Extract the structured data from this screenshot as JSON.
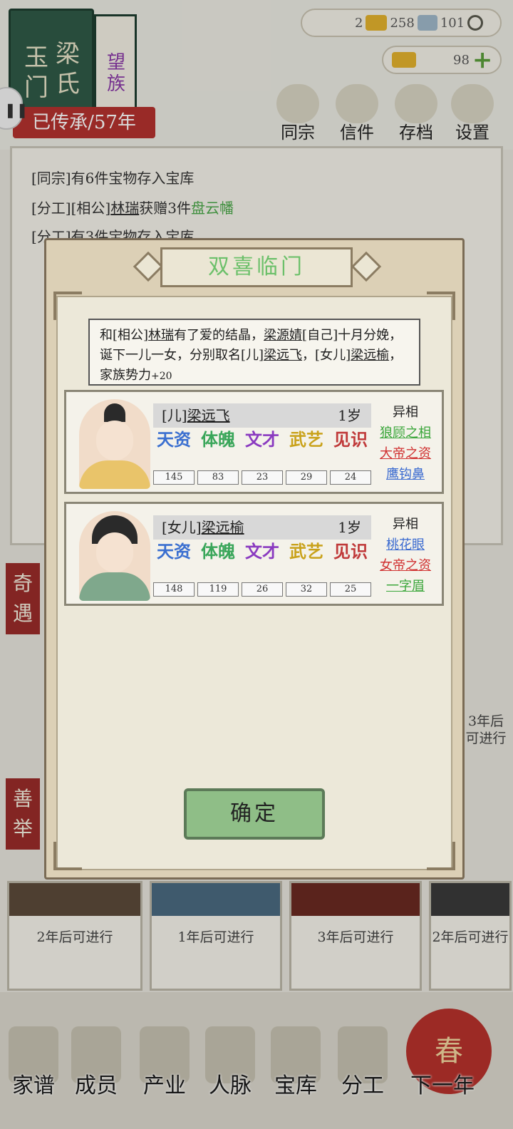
{
  "header": {
    "book_title_1": "玉门",
    "book_title_2": "梁氏",
    "book_tag": "望族",
    "inherit": "已传承/57年"
  },
  "resources": {
    "gold": "2",
    "ingot": "258",
    "silver": "101",
    "yuanbao": "98"
  },
  "top_nav": [
    {
      "label": "同宗",
      "icon": "books-icon"
    },
    {
      "label": "信件",
      "icon": "letter-icon"
    },
    {
      "label": "存档",
      "icon": "scroll-icon"
    },
    {
      "label": "设置",
      "icon": "gear-icon"
    }
  ],
  "log": {
    "line1": "[同宗]有6件宝物存入宝库",
    "line2a": "[分工][相公]",
    "line2b": "林瑞",
    "line2c": "获赠3件",
    "line2d": "盘云幡",
    "line3": "[分工]有3件宝物存入宝库"
  },
  "side_tags": {
    "a": "奇遇",
    "b": "善举"
  },
  "slots": [
    {
      "text": "2年后可进行"
    },
    {
      "text": "1年后可进行"
    },
    {
      "text": "3年后可进行"
    },
    {
      "text": "2年后可进行"
    }
  ],
  "right_slot_text": "3年后可进行",
  "bottom_nav": [
    "家谱",
    "成员",
    "产业",
    "人脉",
    "宝库",
    "分工",
    "下一年"
  ],
  "spring": "春",
  "modal": {
    "title": "双喜临门",
    "msg_a": "和[相公]",
    "msg_b": "林瑞",
    "msg_c": "有了爱的结晶，",
    "msg_d": "梁源婧",
    "msg_e": "[自己]十月分娩，诞下一儿一女，分别取名[儿]",
    "msg_f": "梁远飞",
    "msg_g": "，[女儿]",
    "msg_h": "梁远榆",
    "msg_i": "，家族势力",
    "msg_j": "+20",
    "confirm": "确定"
  },
  "stat_labels": {
    "a": "天资",
    "b": "体魄",
    "c": "文才",
    "d": "武艺",
    "e": "见识"
  },
  "children": [
    {
      "prefix": "[儿]",
      "name": "梁远飞",
      "age": "1岁",
      "stats": [
        "145",
        "83",
        "23",
        "29",
        "24"
      ],
      "traits_header": "异相",
      "traits": [
        "狼顾之相",
        "大帝之资",
        "鹰钩鼻"
      ]
    },
    {
      "prefix": "[女儿]",
      "name": "梁远榆",
      "age": "1岁",
      "stats": [
        "148",
        "119",
        "26",
        "32",
        "25"
      ],
      "traits_header": "异相",
      "traits": [
        "桃花眼",
        "女帝之资",
        "一字眉"
      ]
    }
  ],
  "colors": {
    "stat_a": "#3a6fd0",
    "stat_b": "#3aa65a",
    "stat_c": "#8a3ac0",
    "stat_d": "#c9a21a",
    "stat_e": "#c03a3a",
    "trait_green": "#3aa63a",
    "trait_red": "#d03030",
    "trait_blue": "#3a6ad0"
  }
}
